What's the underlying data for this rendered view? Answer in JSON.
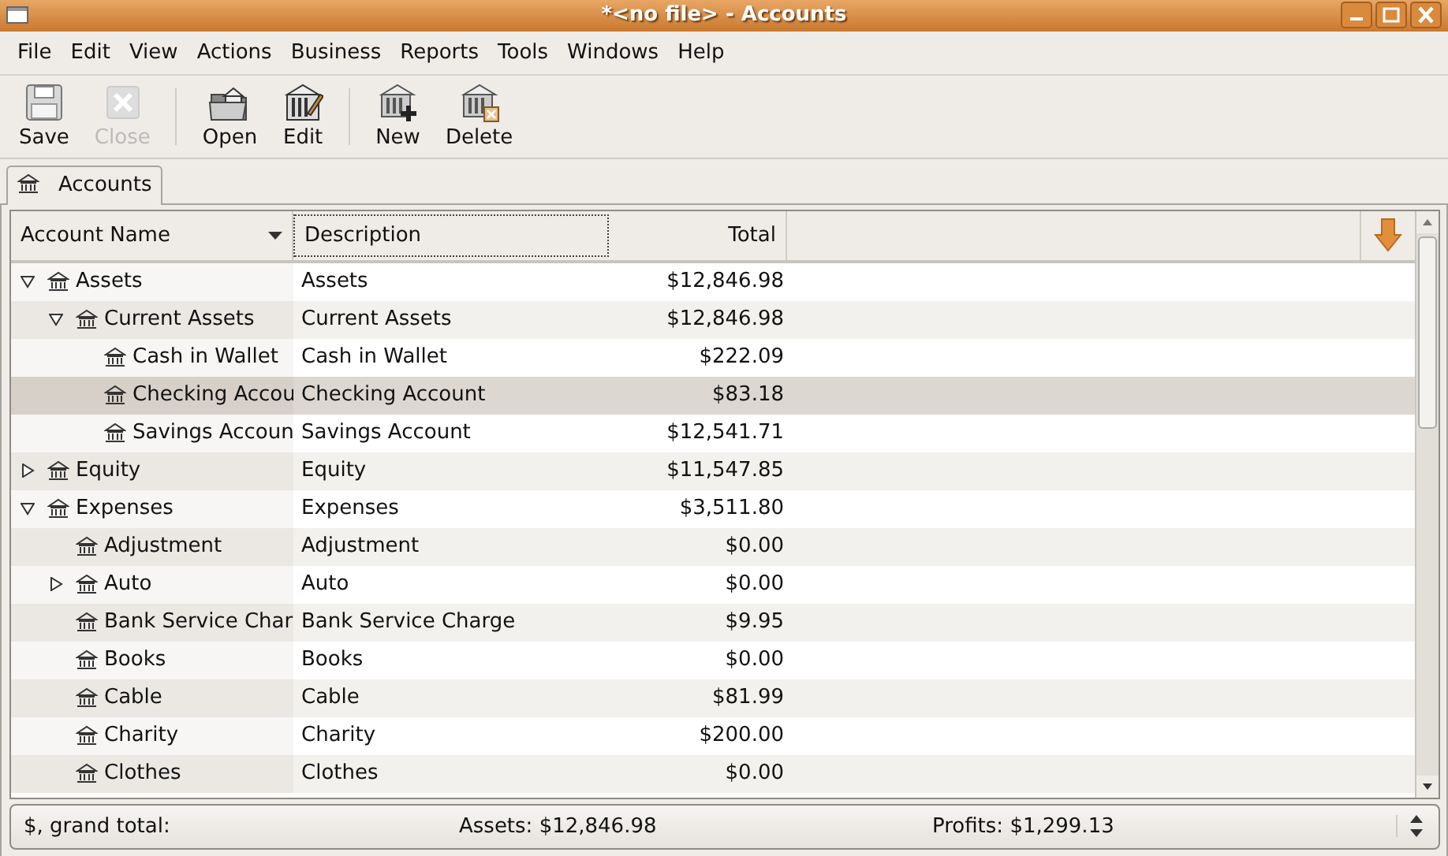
{
  "window": {
    "title": "*<no file> - Accounts"
  },
  "menu": [
    "File",
    "Edit",
    "View",
    "Actions",
    "Business",
    "Reports",
    "Tools",
    "Windows",
    "Help"
  ],
  "toolbar": [
    [
      {
        "kind": "save",
        "label": "Save",
        "disabled": false
      },
      {
        "kind": "close",
        "label": "Close",
        "disabled": true
      }
    ],
    [
      {
        "kind": "open",
        "label": "Open",
        "disabled": false
      },
      {
        "kind": "edit",
        "label": "Edit",
        "disabled": false
      }
    ],
    [
      {
        "kind": "new",
        "label": "New",
        "disabled": false
      },
      {
        "kind": "delete",
        "label": "Delete",
        "disabled": false
      }
    ]
  ],
  "tabs": [
    {
      "label": "Accounts",
      "selected": true
    }
  ],
  "columns": [
    {
      "label": "Account Name",
      "sorted": true,
      "focused": false
    },
    {
      "label": "Description",
      "sorted": false,
      "focused": true
    },
    {
      "label": "Total",
      "sorted": false,
      "focused": false
    }
  ],
  "accounts": [
    {
      "name": "Assets",
      "description": "Assets",
      "total": "$12,846.98",
      "selected": false,
      "expanded": true,
      "children": [
        {
          "name": "Current Assets",
          "description": "Current Assets",
          "total": "$12,846.98",
          "selected": false,
          "expanded": true,
          "children": [
            {
              "name": "Cash in Wallet",
              "description": "Cash in Wallet",
              "total": "$222.09",
              "selected": false
            },
            {
              "name": "Checking Accou",
              "description": "Checking Account",
              "total": "$83.18",
              "selected": true
            },
            {
              "name": "Savings Accoun",
              "description": "Savings Account",
              "total": "$12,541.71",
              "selected": false
            }
          ]
        }
      ]
    },
    {
      "name": "Equity",
      "description": "Equity",
      "total": "$11,547.85",
      "selected": false,
      "expanded": false
    },
    {
      "name": "Expenses",
      "description": "Expenses",
      "total": "$3,511.80",
      "selected": false,
      "expanded": true,
      "children": [
        {
          "name": "Adjustment",
          "description": "Adjustment",
          "total": "$0.00",
          "selected": false
        },
        {
          "name": "Auto",
          "description": "Auto",
          "total": "$0.00",
          "selected": false,
          "expanded": false
        },
        {
          "name": "Bank Service Char",
          "description": "Bank Service Charge",
          "total": "$9.95",
          "selected": false
        },
        {
          "name": "Books",
          "description": "Books",
          "total": "$0.00",
          "selected": false
        },
        {
          "name": "Cable",
          "description": "Cable",
          "total": "$81.99",
          "selected": false
        },
        {
          "name": "Charity",
          "description": "Charity",
          "total": "$200.00",
          "selected": false
        },
        {
          "name": "Clothes",
          "description": "Clothes",
          "total": "$0.00",
          "selected": false
        }
      ]
    }
  ],
  "summary": {
    "label": "$, grand total:",
    "assets": "Assets: $12,846.98",
    "profits": "Profits: $1,299.13"
  }
}
